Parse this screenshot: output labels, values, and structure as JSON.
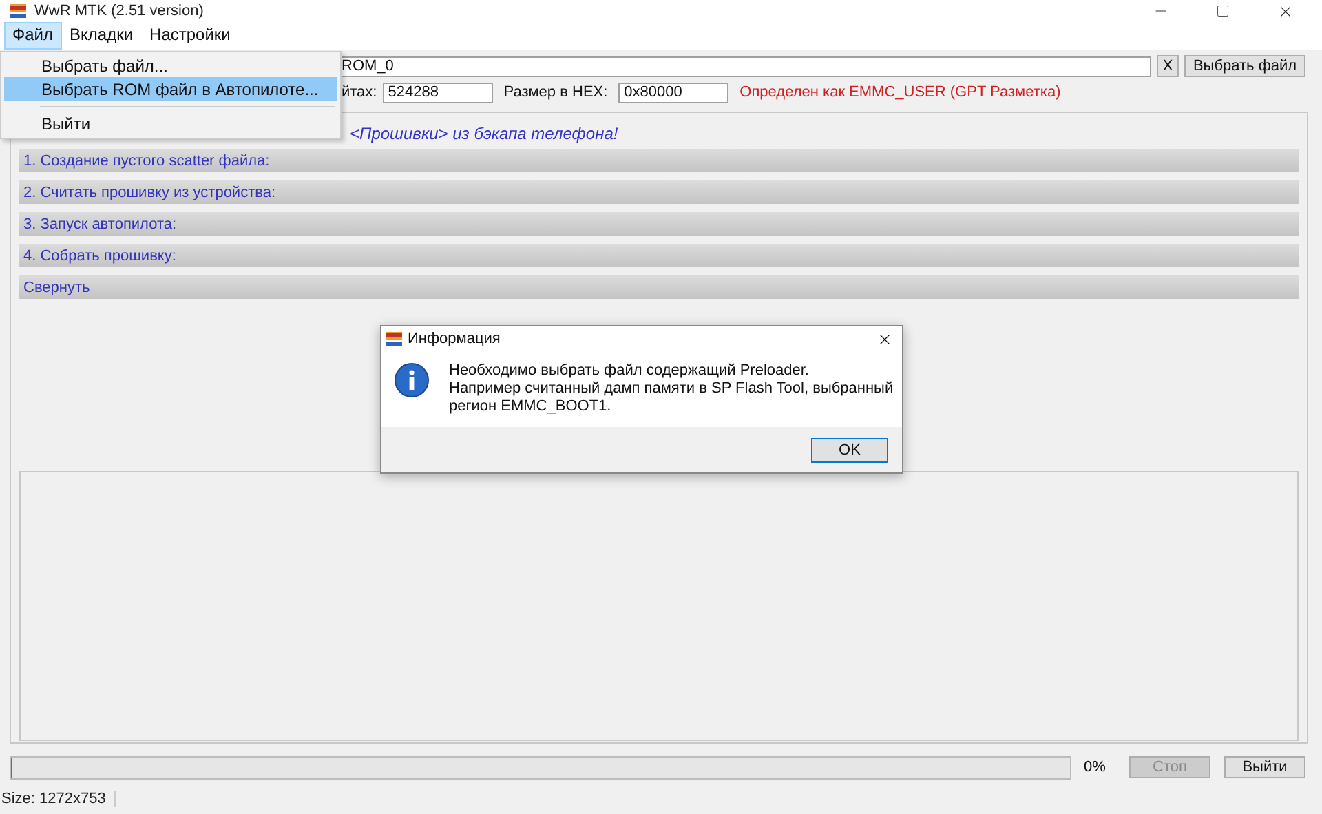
{
  "window": {
    "title": "WwR MTK (2.51 version)"
  },
  "menu_bar": [
    {
      "label": "Файл",
      "selected": true
    },
    {
      "label": "Вкладки",
      "selected": false
    },
    {
      "label": "Настройки",
      "selected": false
    }
  ],
  "file_menu": [
    {
      "kind": "item",
      "label": "Выбрать файл...",
      "selected": false
    },
    {
      "kind": "item",
      "label": "Выбрать ROM файл в Автопилоте...",
      "selected": true
    },
    {
      "kind": "separator"
    },
    {
      "kind": "item",
      "label": "Выйти",
      "selected": false
    }
  ],
  "file_row": {
    "path_value": "ROM_0",
    "clear_button": "X",
    "browse_button": "Выбрать файл"
  },
  "size_row": {
    "size_label": "йтах:",
    "size_value": "524288",
    "hex_label": "Размер в HEX:",
    "hex_value": "0x80000",
    "detected": "Определен как EMMC_USER (GPT Разметка)"
  },
  "notice": "<Прошивки> из бэкапа телефона!",
  "sections": [
    {
      "label": "1. Создание пустого scatter файла:"
    },
    {
      "label": "2. Считать прошивку из устройства:"
    },
    {
      "label": "3. Запуск автопилота:"
    },
    {
      "label": "4. Собрать прошивку:"
    },
    {
      "label": "Свернуть"
    }
  ],
  "dialog": {
    "title": "Информация",
    "message": [
      "Необходимо выбрать файл содержащий Preloader.",
      "Например считанный дамп памяти в SP Flash Tool, выбранный",
      "регион EMMC_BOOT1."
    ],
    "ok_button": "OK"
  },
  "progress": {
    "level": 0,
    "reading": "0%"
  },
  "buttons": [
    {
      "label": "Стоп",
      "disabled": true
    },
    {
      "label": "Выйти",
      "disabled": false
    }
  ],
  "status_bar": "Size: 1272x753"
}
